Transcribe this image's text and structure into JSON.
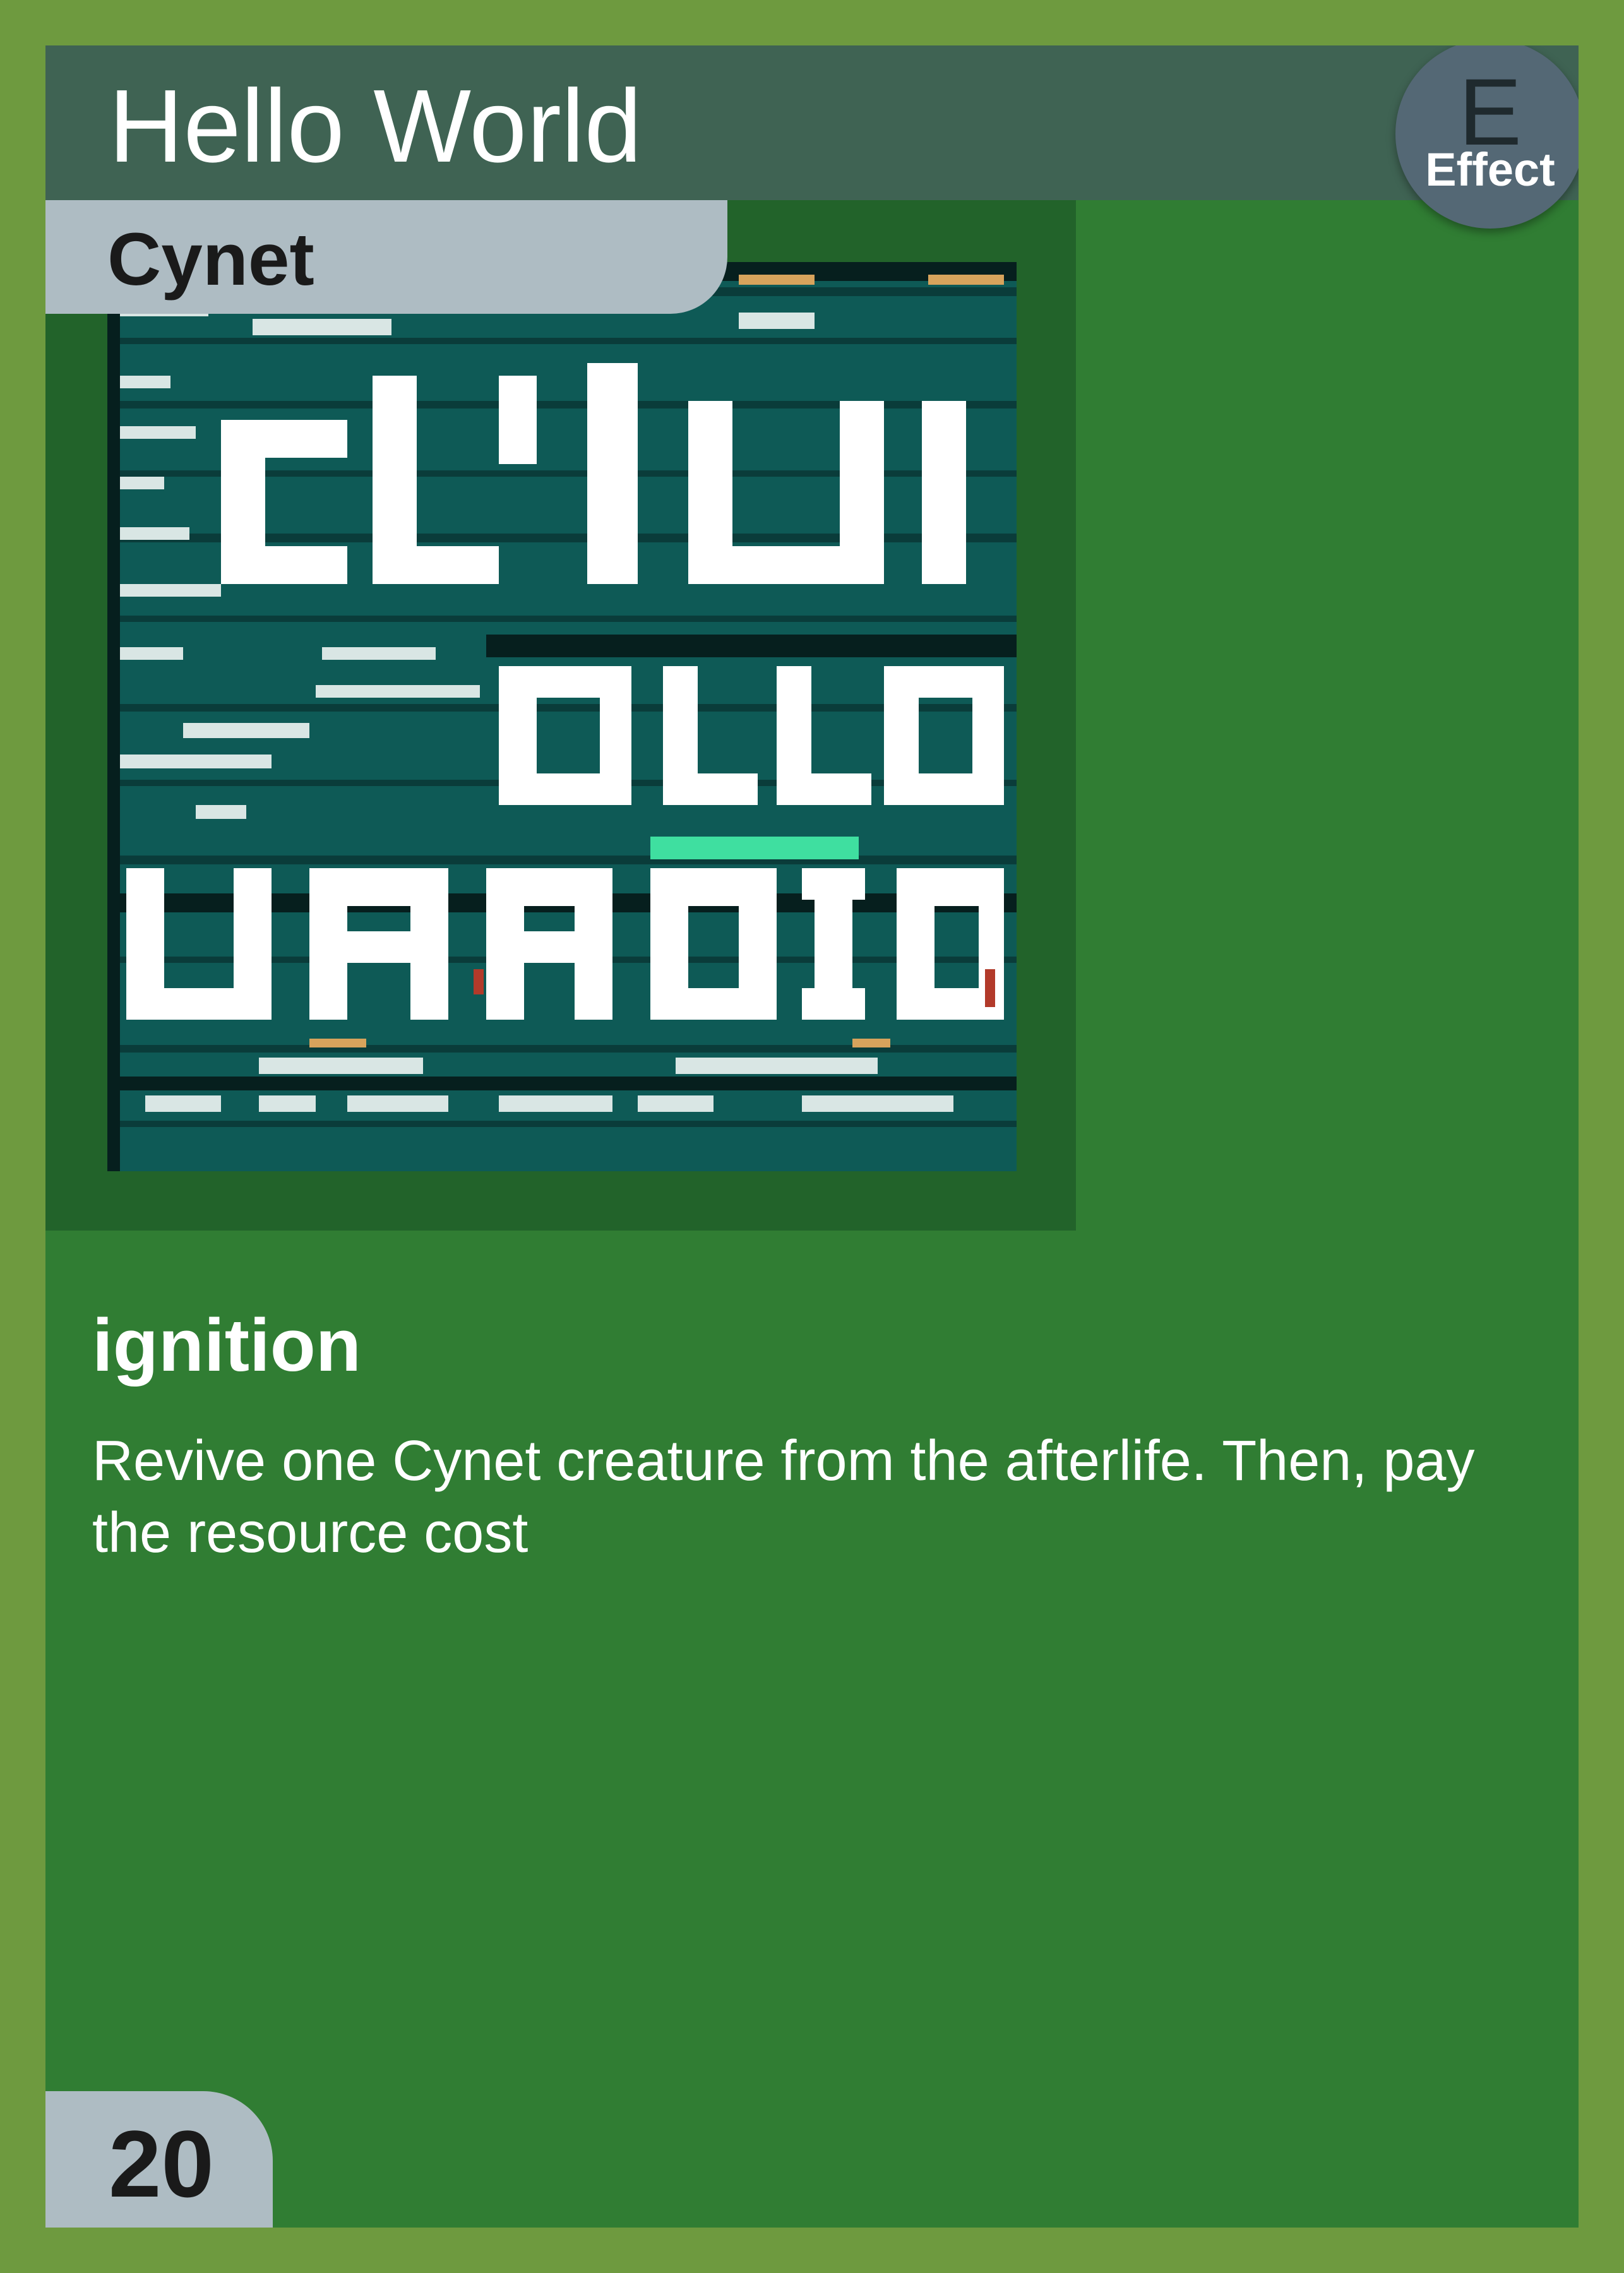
{
  "card": {
    "title": "Hello World",
    "type_letter": "E",
    "type_label": "Effect",
    "faction": "Cynet",
    "ability_name": "ignition",
    "ability_text": "Revive one Cynet creature from the afterlife. Then, pay the resource cost",
    "cost": "20"
  },
  "colors": {
    "border": "#6e9a3f",
    "card_body": "#307d33",
    "title_bar": "#3f6353",
    "art_frame": "#22632a",
    "tab": "#aebcc3",
    "badge": "#546875",
    "art_bg": "#0e5a56"
  }
}
